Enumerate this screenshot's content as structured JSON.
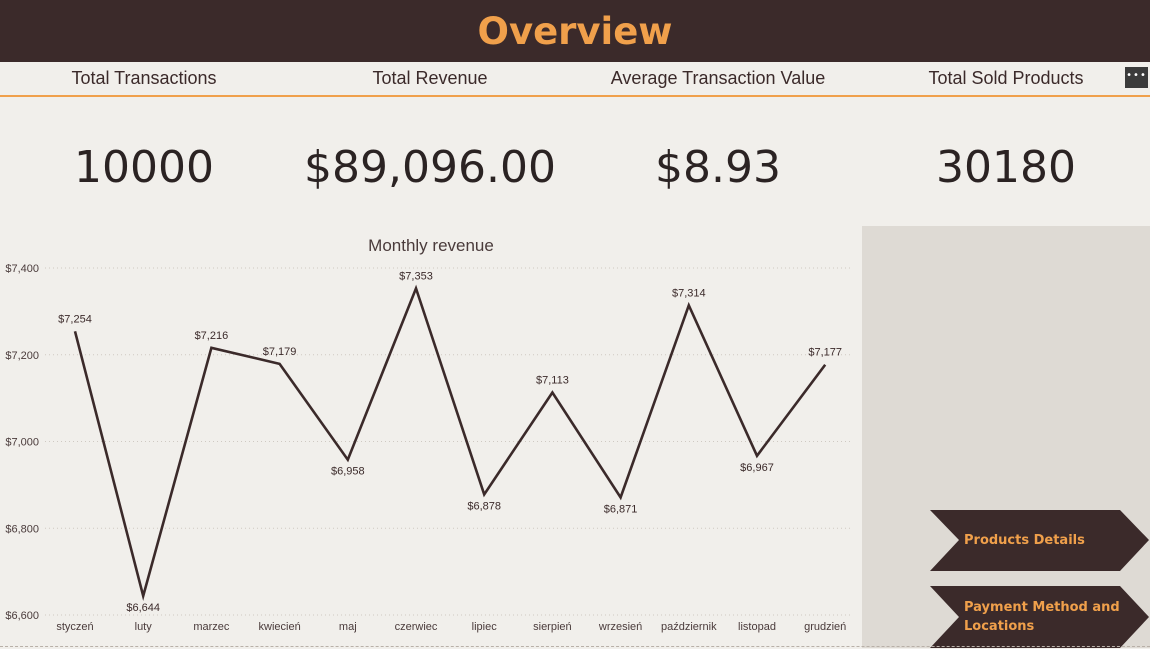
{
  "header": {
    "title": "Overview"
  },
  "kpis": [
    {
      "label": "Total Transactions",
      "value": "10000"
    },
    {
      "label": "Total Revenue",
      "value": "$89,096.00"
    },
    {
      "label": "Average Transaction Value",
      "value": "$8.93"
    },
    {
      "label": "Total Sold Products",
      "value": "30180"
    }
  ],
  "more_button": {
    "icon": "ellipsis-icon",
    "glyph": "•••"
  },
  "nav": {
    "products_details": "Products Details",
    "payment_line1": "Payment Method and",
    "payment_line2": "Locations"
  },
  "colors": {
    "header_bg": "#3b2a2a",
    "accent": "#f0a04b",
    "line": "#3b2a2a",
    "panel": "#dedad4",
    "background": "#f1efeb"
  },
  "chart_data": {
    "type": "line",
    "title": "Monthly revenue",
    "categories": [
      "styczeń",
      "luty",
      "marzec",
      "kwiecień",
      "maj",
      "czerwiec",
      "lipiec",
      "sierpień",
      "wrzesień",
      "październik",
      "listopad",
      "grudzień"
    ],
    "values": [
      7254,
      6644,
      7216,
      7179,
      6958,
      7353,
      6878,
      7113,
      6871,
      7314,
      6967,
      7177
    ],
    "data_labels": [
      "$7,254",
      "$6,644",
      "$7,216",
      "$7,179",
      "$6,958",
      "$7,353",
      "$6,878",
      "$7,113",
      "$6,871",
      "$7,314",
      "$6,967",
      "$7,177"
    ],
    "y_ticks": [
      7400,
      7200,
      7000,
      6800,
      6600
    ],
    "y_tick_labels": [
      "$7,400",
      "$7,200",
      "$7,000",
      "$6,800",
      "$6,600"
    ],
    "ylim": [
      6600,
      7400
    ],
    "grid": true,
    "legend": "none"
  }
}
